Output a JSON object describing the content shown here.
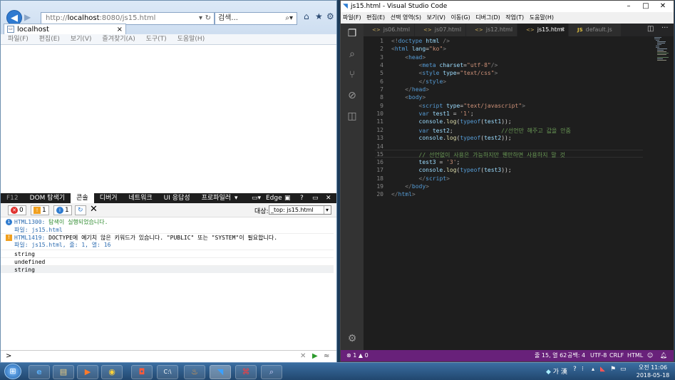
{
  "ie": {
    "address": {
      "prefix": "http://",
      "host": "localhost",
      "rest": ":8080/js15.html"
    },
    "search_text": "검색...",
    "tab_label": "localhost",
    "menu": [
      "파일(F)",
      "편집(E)",
      "보기(V)",
      "즐겨찾기(A)",
      "도구(T)",
      "도움말(H)"
    ]
  },
  "devtools": {
    "f12": "F12",
    "tabs": [
      "DOM 탐색기",
      "콘솔",
      "디버거",
      "네트워크",
      "UI 응답성",
      "프로파일러"
    ],
    "edge_label": "Edge",
    "counts": {
      "errors": "0",
      "warnings": "1",
      "info": "1"
    },
    "target_label": "대상:",
    "target_value": "_top: js15.html",
    "console": [
      {
        "code": "HTML1300:",
        "msg": " 탐색이 실행되었습니다."
      },
      {
        "msg": "파일: js15.html"
      },
      {
        "code": "HTML1419:",
        "msg": " DOCTYPE에 예기치 않은 키워드가 있습니다. \"PUBLIC\" 또는 \"SYSTEM\"이 필요합니다."
      },
      {
        "msg": "파일: js15.html, 줄: 1, 열: 16"
      },
      {
        "msg": "string"
      },
      {
        "msg": "undefined"
      },
      {
        "msg": "string"
      }
    ],
    "prompt": ">"
  },
  "vscode": {
    "title": "js15.html - Visual Studio Code",
    "menu": [
      "파일(F)",
      "편집(E)",
      "선택 영역(S)",
      "보기(V)",
      "이동(G)",
      "디버그(D)",
      "작업(T)",
      "도움말(H)"
    ],
    "tabs": [
      "js06.html",
      "js07.html",
      "js12.html",
      "js15.html",
      "default.js"
    ],
    "active_tab": "js15.html",
    "line_numbers": [
      "1",
      "2",
      "3",
      "4",
      "5",
      "6",
      "7",
      "8",
      "9",
      "10",
      "11",
      "12",
      "13",
      "14",
      "15",
      "16",
      "17",
      "18",
      "19",
      "20"
    ],
    "status": {
      "problems": "⊗ 1 ▲ 0",
      "position": "줄 15, 열 62",
      "spaces": "공백: 4",
      "encoding": "UTF-8",
      "eol": "CRLF",
      "language": "HTML"
    }
  },
  "taskbar": {
    "time": "오전 11:06",
    "date": "2018-05-18",
    "ime": "가 漢"
  }
}
